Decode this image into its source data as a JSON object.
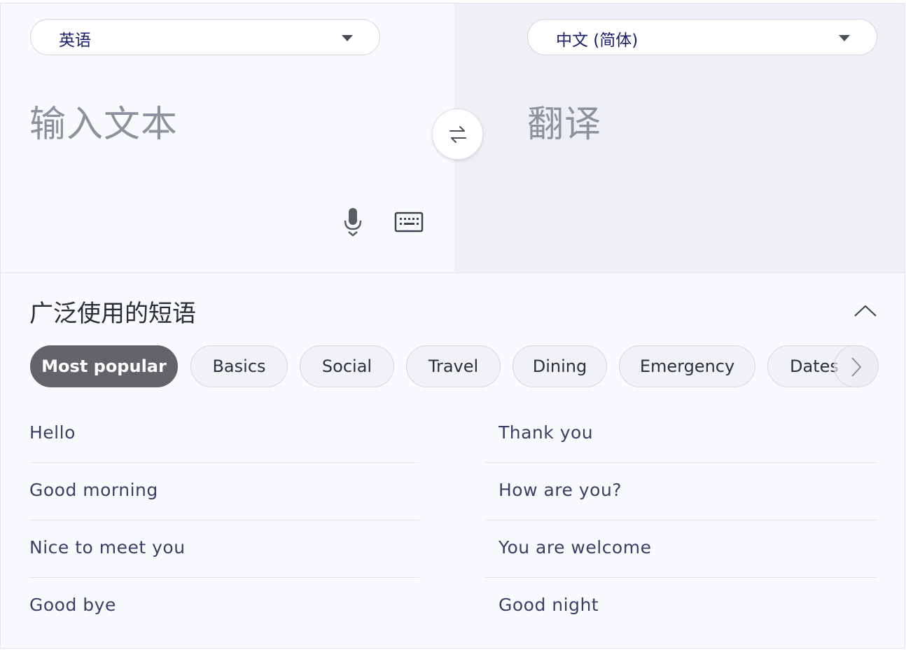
{
  "source_lang": {
    "label": "英语"
  },
  "target_lang": {
    "label": "中文 (简体)"
  },
  "input": {
    "placeholder": "输入文本"
  },
  "output": {
    "placeholder": "翻译"
  },
  "icons": {
    "swap": "swap-arrows-icon",
    "mic": "microphone-icon",
    "keyboard": "keyboard-icon",
    "collapse": "chevron-up-icon",
    "next": "chevron-right-icon",
    "dropdown": "caret-down-icon"
  },
  "phrases_section": {
    "title": "广泛使用的短语",
    "categories": [
      "Most popular",
      "Basics",
      "Social",
      "Travel",
      "Dining",
      "Emergency",
      "Dates"
    ],
    "active_category": "Most popular",
    "left_column": [
      "Hello",
      "Good morning",
      "Nice to meet you",
      "Good bye"
    ],
    "right_column": [
      "Thank you",
      "How are you?",
      "You are welcome",
      "Good night"
    ]
  },
  "colors": {
    "lang_text": "#1a1d6b",
    "phrase_text": "#3a3f66",
    "active_chip": "#626469",
    "right_panel": "#eff0f5"
  }
}
